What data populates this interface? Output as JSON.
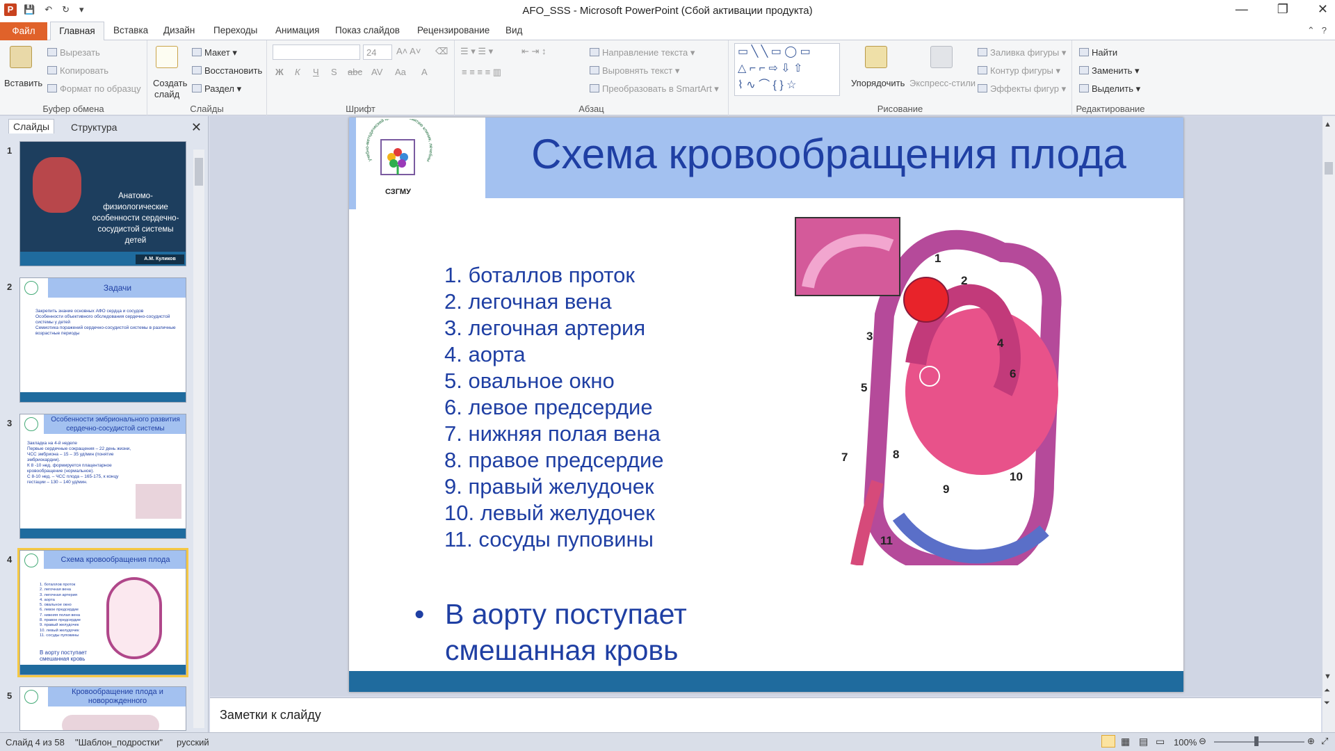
{
  "window": {
    "title": "AFO_SSS  -  Microsoft PowerPoint (Сбой активации продукта)",
    "app_icon": "P",
    "qat_icons": [
      "save-icon",
      "undo-icon",
      "redo-icon",
      "customize-icon"
    ]
  },
  "ribbon_tabs": {
    "file": "Файл",
    "active": "Главная",
    "others": [
      "Вставка",
      "Дизайн",
      "Переходы",
      "Анимация",
      "Показ слайдов",
      "Рецензирование",
      "Вид"
    ]
  },
  "ribbon": {
    "clipboard": {
      "paste": "Вставить",
      "cut": "Вырезать",
      "copy": "Копировать",
      "format_painter": "Формат по образцу",
      "label": "Буфер обмена"
    },
    "slides": {
      "new_slide_line1": "Создать",
      "new_slide_line2": "слайд",
      "layout": "Макет",
      "reset": "Восстановить",
      "section": "Раздел",
      "label": "Слайды"
    },
    "font": {
      "font_size": "24",
      "label": "Шрифт",
      "bold": "Ж",
      "italic": "К",
      "underline": "Ч",
      "shadow": "S",
      "strike": "abc",
      "spacing": "AV",
      "case": "Aa",
      "color": "A"
    },
    "paragraph": {
      "text_direction": "Направление текста",
      "align_text": "Выровнять текст",
      "smartart": "Преобразовать в SmartArt",
      "label": "Абзац"
    },
    "drawing": {
      "arrange": "Упорядочить",
      "quick_styles": "Экспресс-стили",
      "shape_fill": "Заливка фигуры",
      "shape_outline": "Контур фигуры",
      "shape_effects": "Эффекты фигур",
      "label": "Рисование"
    },
    "editing": {
      "find": "Найти",
      "replace": "Заменить",
      "select": "Выделить",
      "label": "Редактирование"
    }
  },
  "panel": {
    "tab_slides": "Слайды",
    "tab_outline": "Структура"
  },
  "thumbnails": [
    {
      "num": "1",
      "title": "Анатомо-физиологические особенности  сердечно-сосудистой системы детей",
      "footer": "А.М. Куликов"
    },
    {
      "num": "2",
      "title": "Задачи",
      "lines": [
        "Закрепить знание основных АФО сердца и сосудов",
        "Особенности объективного обследования сердечно-сосудистой  системы у детей",
        "Семиотика поражений  сердечно-сосудистой системы в различные  возрастные  периоды"
      ]
    },
    {
      "num": "3",
      "title": "Особенности эмбрионального развития сердечно-сосудистой системы",
      "lines": [
        "Закладка на 4-й неделе",
        "Первые сердечные сокращения  – 22 день жизни, ЧСС эмбриона – 15 – 35 уд/мин (понятие эмбриокардии).",
        "К 8 -10 нед. формируется плацентарное  кровообращение (нормальное).",
        "С 8-10 нед. – ЧСС плода – 165-175, к концу гестации – 130 – 140  уд/мин."
      ]
    },
    {
      "num": "4",
      "title": "Схема  кровообращения  плода",
      "lines": [
        "1. боталлов проток",
        "2. легочная вена",
        "3. легочная артерия",
        "4. аорта",
        "5. овальное окно",
        "6. левое предсердие",
        "7. нижняя полая вена",
        "8. правое предсердие",
        "9. правый желудочек",
        "10. левый желудочек",
        "11. сосуды пуповины"
      ],
      "bullet": "В аорту поступает смешанная  кровь"
    },
    {
      "num": "5",
      "title": "Кровообращение плода и новорожденного"
    }
  ],
  "slide": {
    "title": "Схема  кровообращения  плода",
    "logo_org": "учебно-методический центр по развитию клиник, лечебных и коммерческих",
    "logo_text": "СЗГМУ",
    "list": [
      "1. боталлов  проток",
      "2. легочная  вена",
      "3. легочная  артерия",
      "4. аорта",
      "5. овальное  окно",
      "6. левое  предсердие",
      "7. нижняя полая  вена",
      "8. правое  предсердие",
      "9. правый желудочек",
      "10. левый желудочек",
      "11. сосуды пуповины"
    ],
    "bullet": "•",
    "bullet_line1": "В аорту поступает",
    "bullet_line2": "смешанная кровь",
    "diagram_labels": [
      "1",
      "2",
      "3",
      "4",
      "5",
      "6",
      "7",
      "8",
      "9",
      "10",
      "11"
    ]
  },
  "notes": "Заметки к слайду",
  "status": {
    "slide": "Слайд 4 из 58",
    "template": "\"Шаблон_подростки\"",
    "language": "русский",
    "zoom": "100%"
  }
}
